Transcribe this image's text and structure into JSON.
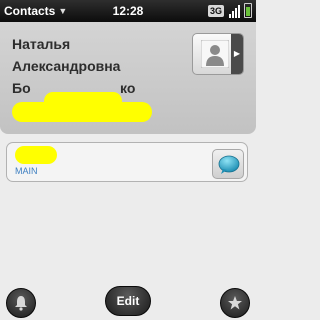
{
  "status_bar": {
    "app_menu_label": "Contacts",
    "clock": "12:28",
    "network": "3G"
  },
  "contact": {
    "first_name": "Наталья",
    "middle_name": "Александровна",
    "last_name_visible": "Бо",
    "last_name_suffix": "ко"
  },
  "phone_entry": {
    "label": "MAIN"
  },
  "bottom_bar": {
    "edit_label": "Edit"
  },
  "colors": {
    "accent_blue": "#3d7fc1",
    "redaction": "#ffff00",
    "battery_green": "#6ac13a",
    "message_bubble": "#2aa7c9"
  },
  "icons": {
    "notification": "bell-icon",
    "favorite": "star-icon",
    "messaging": "chat-bubble-icon",
    "contact_photo": "person-silhouette-icon"
  }
}
